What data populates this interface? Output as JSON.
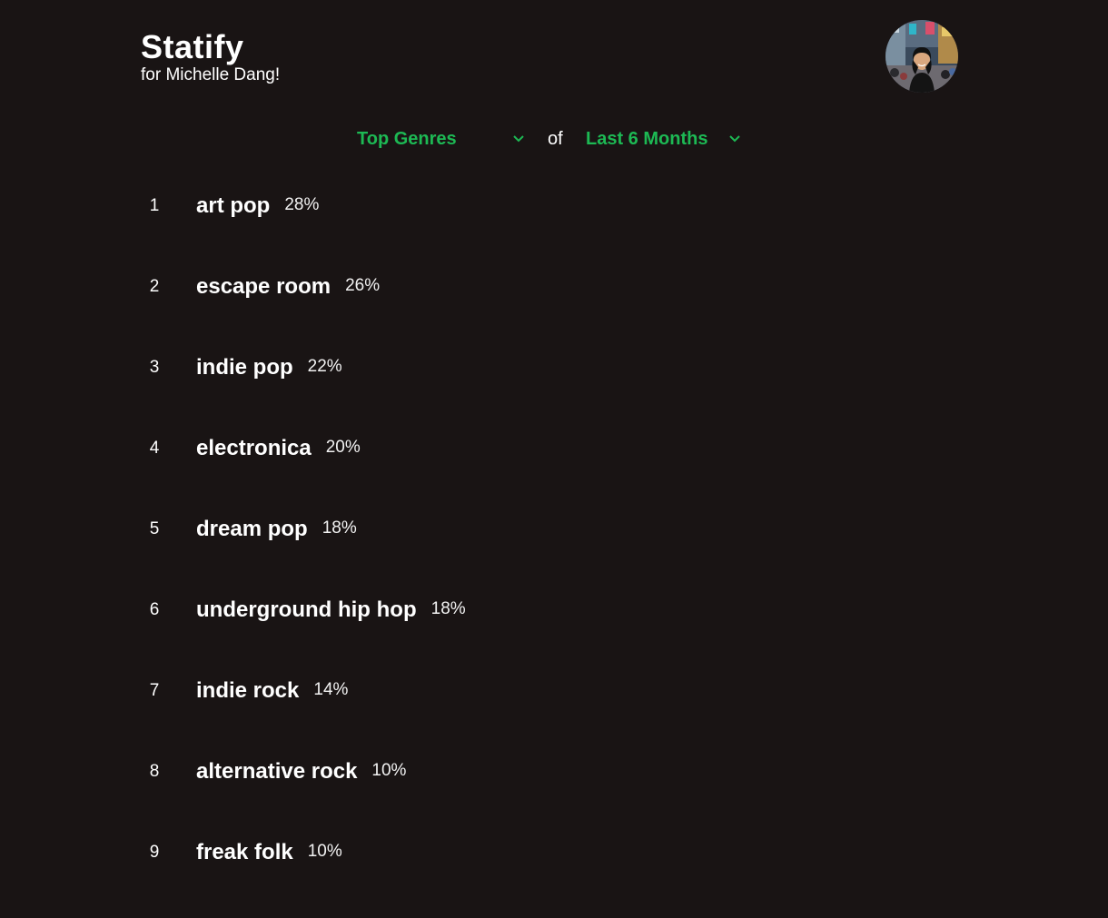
{
  "app": {
    "title": "Statify",
    "subtitle": "for Michelle Dang!"
  },
  "selectors": {
    "category": "Top Genres",
    "connector": "of",
    "time_range": "Last 6 Months"
  },
  "genres": [
    {
      "rank": "1",
      "name": "art pop",
      "percent": "28%"
    },
    {
      "rank": "2",
      "name": "escape room",
      "percent": "26%"
    },
    {
      "rank": "3",
      "name": "indie pop",
      "percent": "22%"
    },
    {
      "rank": "4",
      "name": "electronica",
      "percent": "20%"
    },
    {
      "rank": "5",
      "name": "dream pop",
      "percent": "18%"
    },
    {
      "rank": "6",
      "name": "underground hip hop",
      "percent": "18%"
    },
    {
      "rank": "7",
      "name": "indie rock",
      "percent": "14%"
    },
    {
      "rank": "8",
      "name": "alternative rock",
      "percent": "10%"
    },
    {
      "rank": "9",
      "name": "freak folk",
      "percent": "10%"
    }
  ],
  "colors": {
    "background": "#191414",
    "accent": "#1db954",
    "text": "#ffffff"
  }
}
